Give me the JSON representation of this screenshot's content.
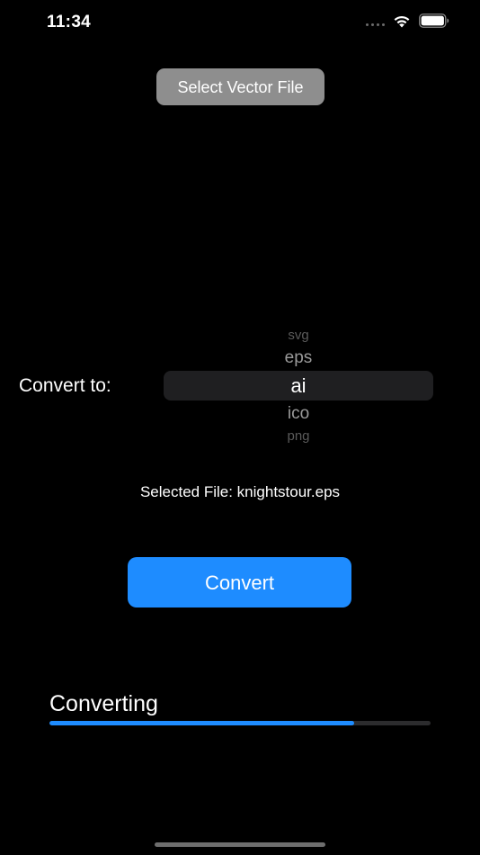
{
  "status_bar": {
    "time": "11:34",
    "icons": [
      "signal-dots-icon",
      "wifi-icon",
      "battery-icon"
    ]
  },
  "select_file_button": {
    "label": "Select Vector File"
  },
  "format_picker": {
    "label": "Convert to:",
    "options": [
      "svg",
      "eps",
      "ai",
      "ico",
      "png"
    ],
    "selected": "ai"
  },
  "selected_file": {
    "text": "Selected File: knightstour.eps"
  },
  "convert_button": {
    "label": "Convert"
  },
  "progress": {
    "label": "Converting",
    "fraction": 0.8
  },
  "colors": {
    "background": "#000000",
    "accent": "#1e8cff",
    "select_button": "#8e8e8e",
    "picker_highlight": "#1f1f21",
    "track": "#2c2c2e"
  }
}
